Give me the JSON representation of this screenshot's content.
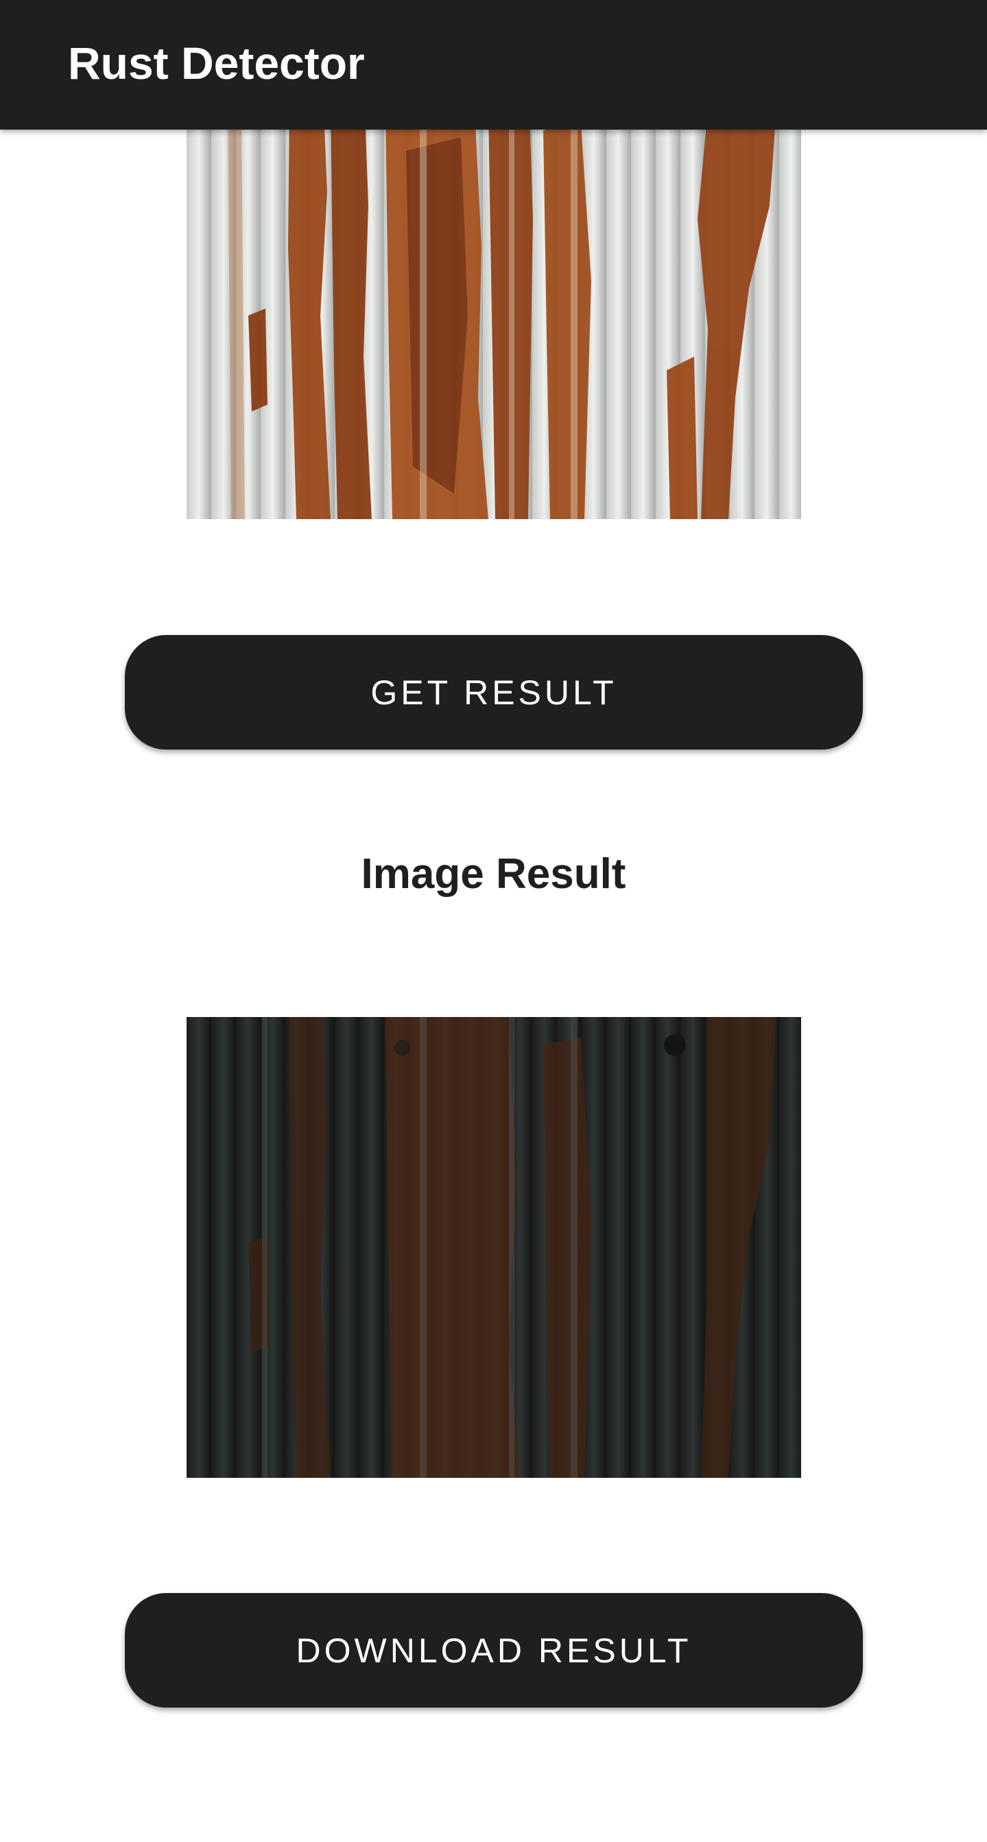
{
  "app_bar": {
    "title": "Rust Detector"
  },
  "input_image": {
    "icon": "rusty-corrugated-metal-photo"
  },
  "actions": {
    "get_result_label": "GET RESULT",
    "download_result_label": "DOWNLOAD RESULT"
  },
  "result": {
    "heading": "Image Result",
    "icon": "rust-detection-output-photo"
  },
  "colors": {
    "app_bar": "#1f1f1f",
    "button": "#1f1f1f",
    "background": "#ffffff",
    "text_on_dark": "#ffffff",
    "heading_text": "#1f1f1f"
  }
}
